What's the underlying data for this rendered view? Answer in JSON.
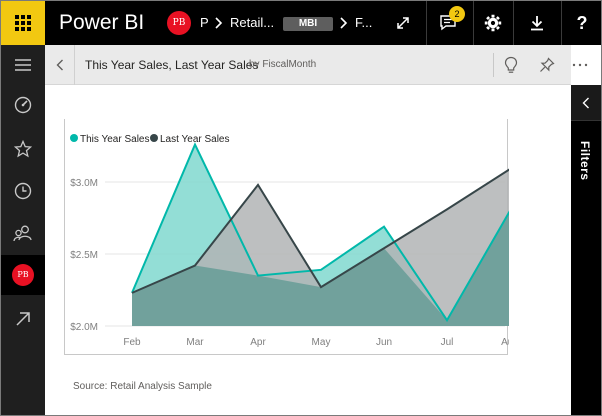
{
  "topbar": {
    "app_title": "Power BI",
    "avatar_initials": "PB",
    "crumb_p": "P",
    "crumb_retail": "Retail...",
    "badge": "MBI",
    "crumb_f": "F...",
    "notification_count": "2"
  },
  "tile": {
    "title": "This Year Sales, Last Year Sales",
    "subtitle": "by FiscalMonth",
    "source": "Source: Retail Analysis Sample"
  },
  "filters": {
    "label": "Filters"
  },
  "leftnav": {
    "avatar_initials": "PB"
  },
  "colors": {
    "accent": "#f2c811",
    "this_year": "#01b8aa",
    "this_year_fill": "#80d8cf",
    "last_year": "#374649",
    "last_year_fill": "#b1b4b5",
    "overlap_fill": "#6a9e99"
  },
  "chart_data": {
    "type": "area",
    "categories": [
      "Feb",
      "Mar",
      "Apr",
      "May",
      "Jun",
      "Jul",
      "Aug"
    ],
    "series": [
      {
        "name": "This Year Sales",
        "values": [
          2.23,
          3.26,
          2.35,
          2.39,
          2.69,
          2.04,
          2.8
        ]
      },
      {
        "name": "Last Year Sales",
        "values": [
          2.23,
          2.42,
          2.98,
          2.27,
          2.54,
          2.81,
          3.09
        ]
      }
    ],
    "yticks": [
      "$2.0M",
      "$2.5M",
      "$3.0M"
    ],
    "ytick_values": [
      2.0,
      2.5,
      3.0
    ],
    "ylim": [
      2.0,
      3.3
    ],
    "legend_position": "top-left",
    "grid": true
  }
}
